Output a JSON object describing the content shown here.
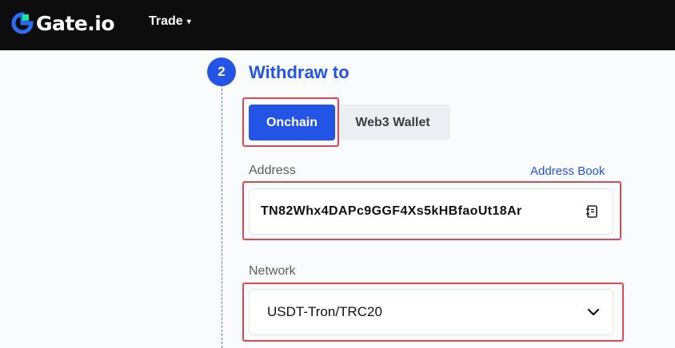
{
  "header": {
    "brand": "Gate.io",
    "nav": [
      {
        "label": "Trade",
        "caret": "▾"
      }
    ]
  },
  "step": {
    "number": "2",
    "title": "Withdraw to"
  },
  "tabs": [
    {
      "label": "Onchain",
      "active": true
    },
    {
      "label": "Web3 Wallet",
      "active": false
    }
  ],
  "address": {
    "label": "Address",
    "link": "Address Book",
    "value": "TN82Whx4DAPc9GGF4Xs5kHBfaoUt18Ar",
    "icon": "address-book-icon"
  },
  "network": {
    "label": "Network",
    "selected": "USDT-Tron/TRC20",
    "icon": "chevron-down-icon"
  },
  "colors": {
    "accent": "#2354e6",
    "header_bg": "#0d0d0d",
    "highlight": "#e0474c",
    "brand_green": "#17e6a1"
  }
}
